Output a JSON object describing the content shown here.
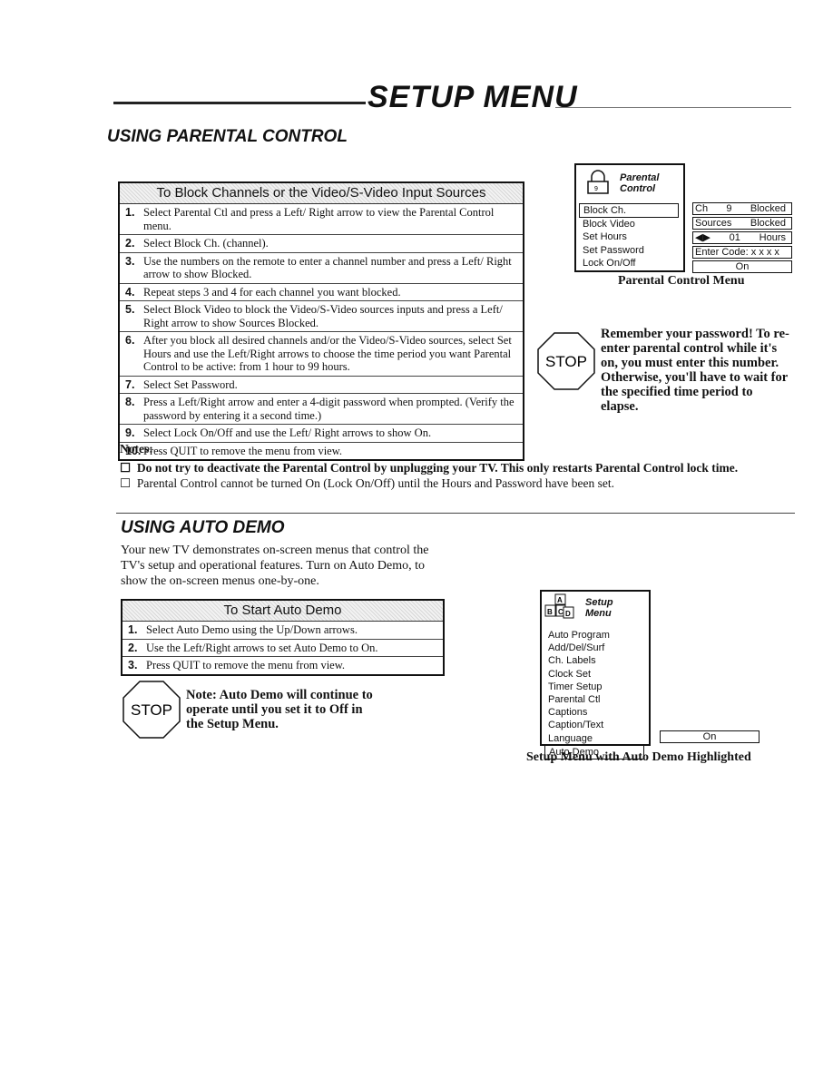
{
  "header": {
    "title": "SETUP MENU"
  },
  "parental": {
    "title": "USING PARENTAL CONTROL",
    "box_title": "To Block Channels or the Video/S-Video Input Sources",
    "steps": [
      {
        "n": "1.",
        "text": "Select Parental Ctl and press a Left/ Right arrow to view the Parental Control menu."
      },
      {
        "n": "2.",
        "text": "Select Block Ch. (channel)."
      },
      {
        "n": "3.",
        "text": "Use the numbers on the remote to enter a channel number and press a Left/ Right arrow to show Blocked."
      },
      {
        "n": "4.",
        "text": "Repeat steps 3 and 4 for each channel you want blocked."
      },
      {
        "n": "5.",
        "text": "Select Block Video to block the Video/S-Video sources inputs and press a Left/ Right arrow to show Sources Blocked."
      },
      {
        "n": "6.",
        "text": "After you block all desired channels and/or the Video/S-Video sources, select Set Hours and use the Left/Right arrows to choose the time period you want Parental Control to be active: from 1 hour to 99 hours."
      },
      {
        "n": "7.",
        "text": "Select Set Password."
      },
      {
        "n": "8.",
        "text": "Press a Left/Right arrow and enter a 4-digit password when prompted. (Verify the password by entering it a second time.)"
      },
      {
        "n": "9.",
        "text": "Select Lock On/Off and use the Left/ Right arrows to show On."
      },
      {
        "n": "10.",
        "text": "Press QUIT to remove the menu from view."
      }
    ],
    "menu": {
      "title_line1": "Parental",
      "title_line2": "Control",
      "icon": "padlock-icon",
      "icon_label": "9",
      "items": [
        "Block Ch.",
        "Block Video",
        "Set Hours",
        "Set Password",
        "Lock On/Off"
      ],
      "values": [
        [
          "Ch",
          "9",
          "Blocked"
        ],
        [
          "Sources",
          "Blocked"
        ],
        [
          "◀▶",
          "01",
          "Hours"
        ],
        [
          "Enter Code: x x x x"
        ],
        [
          "On"
        ]
      ],
      "caption": "Parental Control Menu"
    },
    "stop": {
      "label": "STOP",
      "text": "Remember your password! To re-enter parental control while it's on, you must enter this number. Otherwise, you'll have to wait for the specified time period to elapse."
    },
    "notes_label": "Notes:",
    "notes": [
      "Do not try to deactivate the Parental Control by unplugging your TV. This only restarts Parental Control lock time.",
      "Parental Control cannot be turned On (Lock On/Off) until the Hours and Password have been set."
    ]
  },
  "autodemo": {
    "title": "USING AUTO DEMO",
    "intro": "Your new TV demonstrates on-screen menus that control the TV's setup and operational features. Turn on Auto Demo, to show the on-screen menus one-by-one.",
    "box_title": "To Start Auto Demo",
    "steps": [
      {
        "n": "1.",
        "text": "Select Auto Demo using the Up/Down arrows."
      },
      {
        "n": "2.",
        "text": "Use the Left/Right arrows to set Auto Demo to On."
      },
      {
        "n": "3.",
        "text": "Press QUIT to remove the menu from view."
      }
    ],
    "stop": {
      "label": "STOP",
      "text": "Note: Auto Demo will continue to operate until you set it to Off in the Setup Menu."
    },
    "menu": {
      "title_line1": "Setup",
      "title_line2": "Menu",
      "icon": "abc-blocks-icon",
      "icon_letters": [
        "A",
        "B",
        "C",
        "D"
      ],
      "items": [
        "Auto Program",
        "Add/Del/Surf",
        "Ch. Labels",
        "Clock Set",
        "Timer Setup",
        "Parental Ctl",
        "Captions",
        "Caption/Text",
        "Language",
        "Auto Demo"
      ],
      "value": "On",
      "caption": "Setup Menu with Auto Demo Highlighted"
    }
  }
}
